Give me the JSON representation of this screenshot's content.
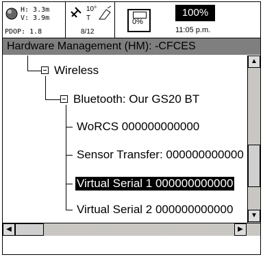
{
  "status_bar": {
    "h_value": "H: 3.3m",
    "v_value": "V: 3.9m",
    "pdop": "PDOP: 1.8",
    "sat_elevation": "10°",
    "sat_mode": "T",
    "sat_count": "8/12",
    "memory_percent": "0%",
    "battery_percent": "100%",
    "time": "11:05 p.m."
  },
  "window": {
    "title": "Hardware Management (HM): -CFCES"
  },
  "tree": {
    "root": "Wireless",
    "child": "Bluetooth: Our GS20 BT",
    "items": [
      {
        "label": "WoRCS 000000000000",
        "selected": false
      },
      {
        "label": "Sensor Transfer: 000000000000",
        "selected": false
      },
      {
        "label": "Virtual Serial 1 000000000000",
        "selected": true
      },
      {
        "label": "Virtual Serial 2 000000000000",
        "selected": false
      }
    ]
  },
  "icons": {
    "gps": "gps-status-icon",
    "satellite": "satellite-icon",
    "antenna": "antenna-icon",
    "memory": "memory-card-icon",
    "battery": "battery-icon"
  }
}
